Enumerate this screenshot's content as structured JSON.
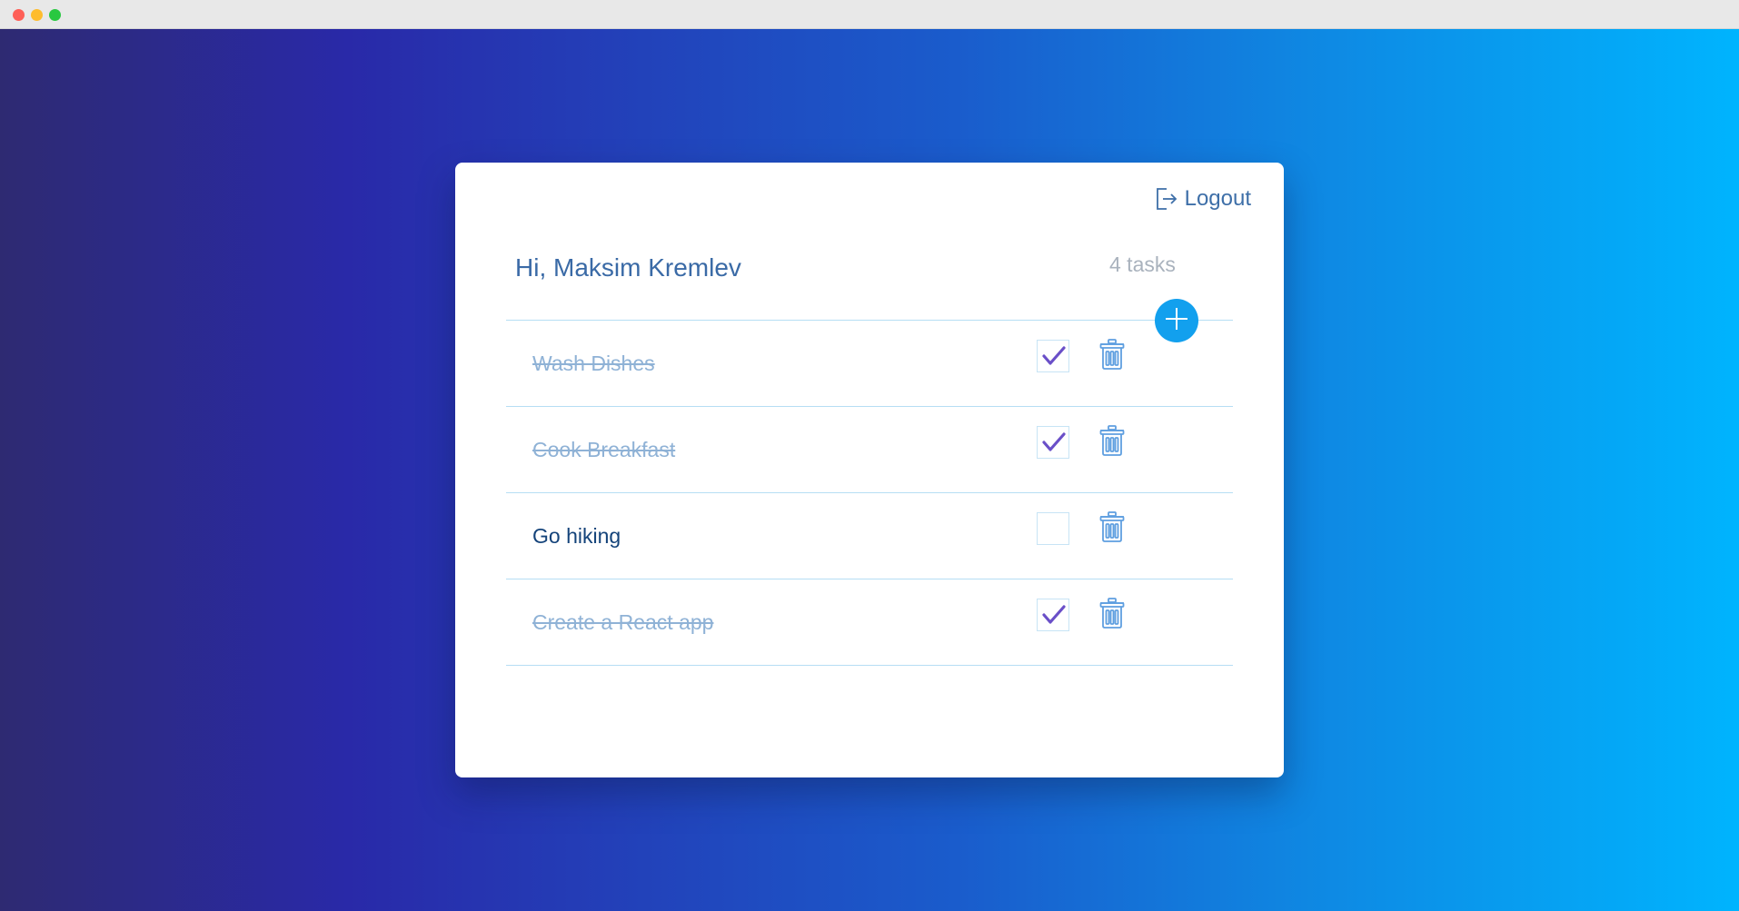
{
  "header": {
    "logout_label": "Logout",
    "greeting": "Hi, Maksim Kremlev",
    "task_count": "4 tasks"
  },
  "icons": {
    "logout": "logout-icon",
    "add": "plus-icon",
    "check": "checkmark-icon",
    "delete": "trash-icon"
  },
  "colors": {
    "accent": "#12a0ee",
    "check": "#6a4fc8",
    "gradient_start": "#2e2a72",
    "gradient_end": "#00b4fe"
  },
  "tasks": [
    {
      "label": "Wash Dishes",
      "completed": true
    },
    {
      "label": "Cook Breakfast",
      "completed": true
    },
    {
      "label": "Go hiking",
      "completed": false
    },
    {
      "label": "Create a React app",
      "completed": true
    }
  ]
}
